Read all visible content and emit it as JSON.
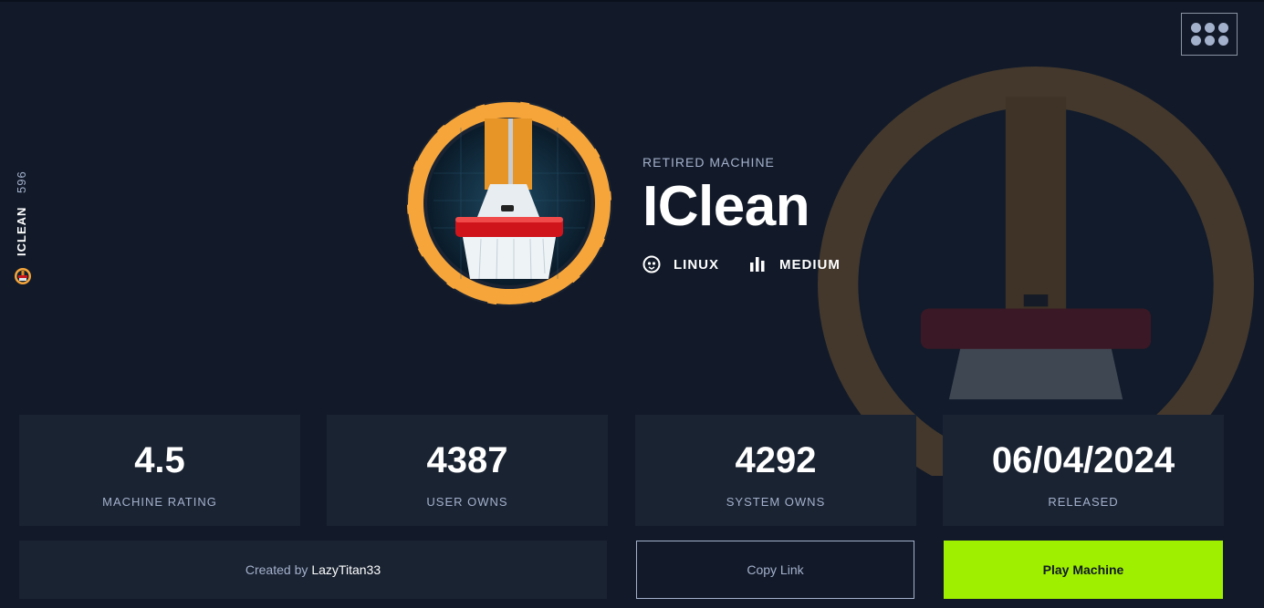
{
  "header": {
    "menu_icon": "grid-menu-icon"
  },
  "sidebar": {
    "name": "ICLEAN",
    "id": "596",
    "icon": "machine-avatar-icon"
  },
  "machine": {
    "kicker": "RETIRED MACHINE",
    "name": "IClean",
    "os": "LINUX",
    "difficulty": "MEDIUM",
    "os_icon": "linux-penguin-icon",
    "difficulty_icon": "bar-chart-icon",
    "logo": "broom-logo"
  },
  "stats": [
    {
      "value": "4.5",
      "label": "MACHINE RATING"
    },
    {
      "value": "4387",
      "label": "USER OWNS"
    },
    {
      "value": "4292",
      "label": "SYSTEM OWNS"
    },
    {
      "value": "06/04/2024",
      "label": "RELEASED"
    }
  ],
  "actions": {
    "created_prefix": "Created by",
    "creator": "LazyTitan33",
    "copy_link": "Copy Link",
    "play": "Play Machine"
  },
  "colors": {
    "background": "#121a29",
    "card": "#1a2332",
    "accent_green": "#9fef00",
    "muted_text": "#a4b1cd",
    "logo_orange": "#f6a53a"
  }
}
